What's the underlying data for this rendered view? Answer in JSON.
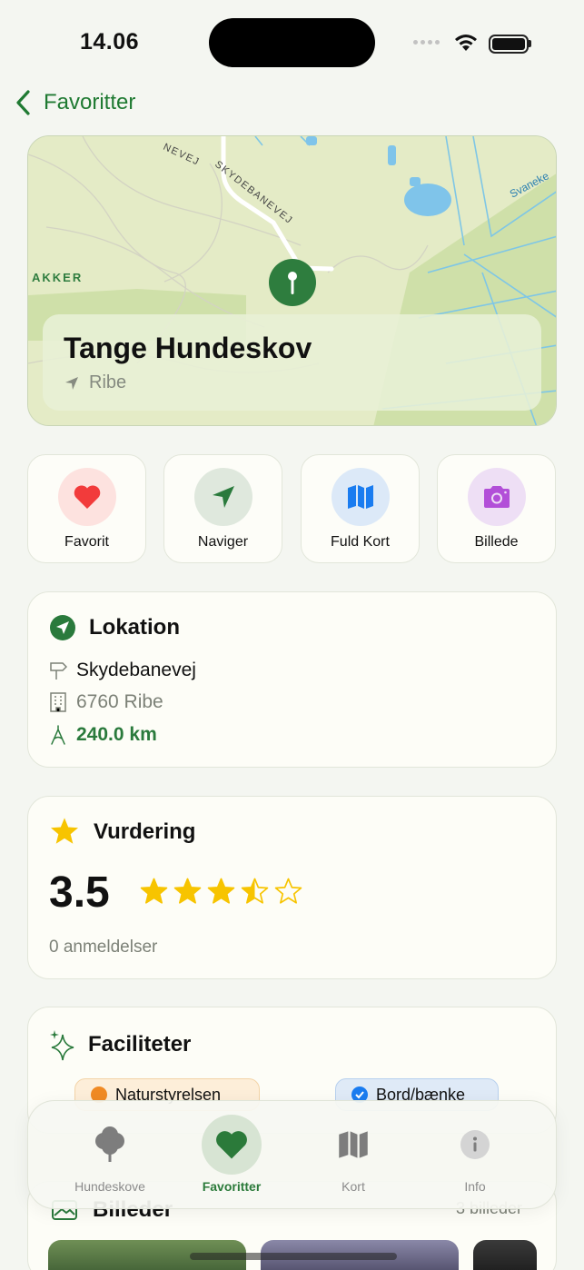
{
  "status_bar": {
    "time": "14.06"
  },
  "nav": {
    "back_label": "Favoritter"
  },
  "map": {
    "road_labels": [
      "NEVEJ",
      "SKYDEBANEVEJ",
      "Svaneke",
      "AKKER"
    ],
    "place_title": "Tange Hundeskov",
    "place_city": "Ribe"
  },
  "actions": [
    {
      "label": "Favorit",
      "icon": "heart-icon",
      "color": "#f23b3b",
      "bg": "#fde2df"
    },
    {
      "label": "Naviger",
      "icon": "navigation-arrow-icon",
      "color": "#2a7a3c",
      "bg": "#dfe8dd"
    },
    {
      "label": "Fuld Kort",
      "icon": "map-icon",
      "color": "#1a7cf0",
      "bg": "#dce9f8"
    },
    {
      "label": "Billede",
      "icon": "camera-icon",
      "color": "#b24fd8",
      "bg": "#eedff5"
    }
  ],
  "location": {
    "title": "Lokation",
    "street": "Skydebanevej",
    "postal": "6760 Ribe",
    "distance": "240.0 km"
  },
  "rating": {
    "title": "Vurdering",
    "value": "3.5",
    "stars": 3.5,
    "max_stars": 5,
    "reviews": "0 anmeldelser"
  },
  "facilities": {
    "title": "Faciliteter",
    "chips": [
      {
        "label": "Naturstyrelsen",
        "color": "#f08a24",
        "bg": "#fdeed9"
      },
      {
        "label": "Bord/bænke",
        "color": "#1a7cf0",
        "bg": "#dfeaf7"
      }
    ]
  },
  "photos": {
    "title": "Billeder",
    "count": "3 billeder"
  },
  "tabbar": {
    "tabs": [
      {
        "label": "Hundeskove",
        "icon": "tree-icon",
        "active": false
      },
      {
        "label": "Favoritter",
        "icon": "heart-icon",
        "active": true
      },
      {
        "label": "Kort",
        "icon": "map-icon",
        "active": false
      },
      {
        "label": "Info",
        "icon": "info-icon",
        "active": false
      }
    ]
  },
  "colors": {
    "accent": "#2b7a3a",
    "star": "#f7c400",
    "background": "#f4f6f1"
  }
}
